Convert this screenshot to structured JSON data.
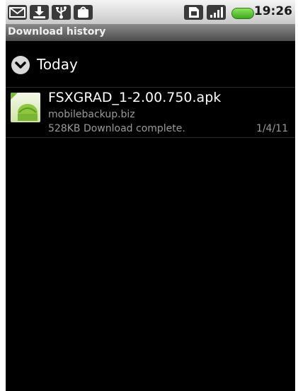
{
  "status_bar": {
    "time": "19:26",
    "notification_icons": [
      "gmail-icon",
      "download-complete-icon",
      "usb-icon",
      "android-market-icon"
    ],
    "system_icons": [
      "sim-card-icon",
      "signal-icon",
      "battery-icon"
    ],
    "battery_color": "#3ea81f"
  },
  "title_bar": {
    "title": "Download history"
  },
  "groups": [
    {
      "label": "Today",
      "icon": "chevron-down-icon",
      "items": [
        {
          "icon": "apk-file-icon",
          "file_name": "FSXGRAD_1-2.00.750.apk",
          "source": "mobilebackup.biz",
          "status": "528KB Download complete.",
          "date": "1/4/11"
        }
      ]
    }
  ]
}
